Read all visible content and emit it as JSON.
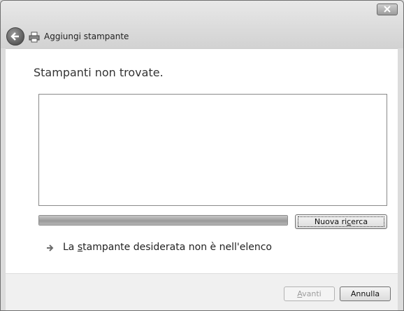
{
  "window": {
    "title": "Aggiungi stampante"
  },
  "icons": {
    "close": "close-icon",
    "back": "back-arrow-icon",
    "printer": "printer-icon",
    "link_arrow": "arrow-right-icon"
  },
  "main": {
    "heading": "Stampanti non trovate.",
    "list_items": [],
    "progress_fraction": 1.0,
    "research_button": {
      "label_pre": "Nuova ri",
      "label_u": "c",
      "label_post": "erca"
    },
    "link": {
      "label_pre": "La ",
      "label_u": "s",
      "label_post": "tampante desiderata non è nell'elenco"
    }
  },
  "footer": {
    "next_button": {
      "label_u": "A",
      "label_post": "vanti",
      "enabled": false
    },
    "cancel_button": {
      "label": "Annulla"
    }
  }
}
